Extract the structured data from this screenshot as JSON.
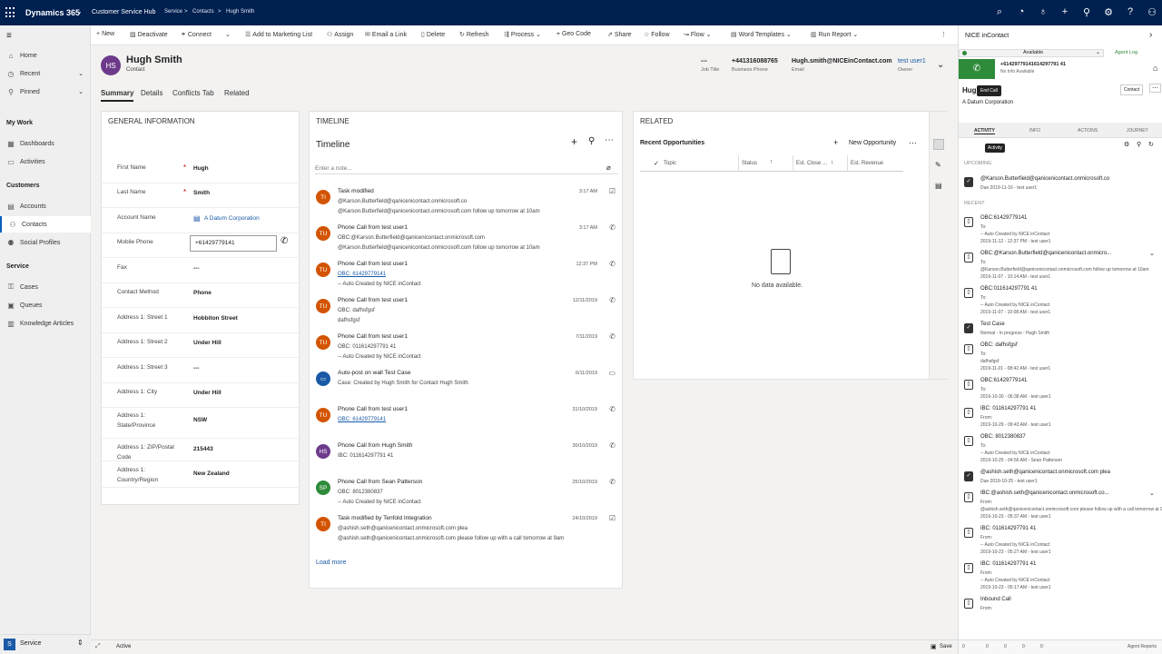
{
  "topbar": {
    "brand": "Dynamics 365",
    "app": "Customer Service Hub",
    "crumbs": [
      "Service",
      ">",
      "Contacts",
      ">",
      "Hugh Smith"
    ]
  },
  "nav": {
    "items_top": [
      "Home",
      "Recent",
      "Pinned"
    ],
    "my_work_head": "My Work",
    "my_work": [
      "Dashboards",
      "Activities"
    ],
    "customers_head": "Customers",
    "customers": [
      "Accounts",
      "Contacts",
      "Social Profiles"
    ],
    "service_head": "Service",
    "service": [
      "Cases",
      "Queues",
      "Knowledge Articles"
    ],
    "area": "Service",
    "area_badge": "S"
  },
  "commands": [
    "New",
    "Deactivate",
    "Connect",
    "Add to Marketing List",
    "Assign",
    "Email a Link",
    "Delete",
    "Refresh",
    "Process",
    "Geo Code",
    "Share",
    "Follow",
    "Flow",
    "Word Templates",
    "Run Report"
  ],
  "record": {
    "initials": "HS",
    "name": "Hugh Smith",
    "entity": "Contact",
    "fields": [
      {
        "value": "---",
        "label": "Job Title"
      },
      {
        "value": "+441316088765",
        "label": "Business Phone"
      },
      {
        "value": "Hugh.smith@NICEinContact.com",
        "label": "Email"
      },
      {
        "value": "test user1",
        "label": "Owner"
      }
    ]
  },
  "tabs": [
    "Summary",
    "Details",
    "Conflicts Tab",
    "Related"
  ],
  "general": {
    "heading": "GENERAL INFORMATION",
    "rows": [
      {
        "label": "First Name",
        "value": "Hugh",
        "required": "*"
      },
      {
        "label": "Last Name",
        "value": "Smith",
        "required": "*"
      },
      {
        "label": "Account Name",
        "value": "A Datum Corporation"
      },
      {
        "label": "Mobile Phone",
        "value": "+61429779141"
      },
      {
        "label": "Fax",
        "value": "---"
      },
      {
        "label": "Contact Method",
        "value": "Phone"
      },
      {
        "label": "Address 1: Street 1",
        "value": "Hobbiton Street"
      },
      {
        "label": "Address 1: Street 2",
        "value": "Under Hill"
      },
      {
        "label": "Address 1: Street 3",
        "value": "---"
      },
      {
        "label": "Address 1: City",
        "value": "Under Hill"
      },
      {
        "label": "Address 1: State/Province",
        "value": "NSW"
      },
      {
        "label": "Address 1: ZIP/Postal Code",
        "value": "215443"
      },
      {
        "label": "Address 1: Country/Region",
        "value": "New Zealand"
      }
    ]
  },
  "timeline": {
    "heading": "TIMELINE",
    "title": "Timeline",
    "note_placeholder": "Enter a note...",
    "load_more": "Load more",
    "items": [
      {
        "initials": "TI",
        "color": "#d35400",
        "title": "Task modified",
        "lines": [
          "@Karson.Butterfield@qanicenicontact.onmicrosoft.co",
          "@Karson.Butterfield@qanicenicontact.onmicrosoft.com follow up tomorrow at 10am"
        ],
        "date": "3:17 AM",
        "icon": "☑"
      },
      {
        "initials": "TU",
        "color": "#d35400",
        "title": "Phone Call from test user1",
        "lines": [
          "OBC:@Karson.Butterfield@qanicenicontact.onmicrosoft.com",
          "@Karson.Butterfield@qanicenicontact.onmicrosoft.com follow up tomorrow at 10am"
        ],
        "date": "3:17 AM",
        "icon": "✆"
      },
      {
        "initials": "TU",
        "color": "#d35400",
        "title": "Phone Call from test user1",
        "lines": [
          "OBC: 61429779141",
          "-- Auto Created by NICE inContact"
        ],
        "date": "12:37 PM",
        "icon": "✆",
        "link_first": true
      },
      {
        "initials": "TU",
        "color": "#d35400",
        "title": "Phone Call from test user1",
        "lines": [
          "OBC: dafhsfgsf",
          "dafhsfgsf"
        ],
        "date": "12/11/2019",
        "icon": "✆"
      },
      {
        "initials": "TU",
        "color": "#d35400",
        "title": "Phone Call from test user1",
        "lines": [
          "OBC: 011614297791 41",
          "-- Auto Created by NICE inContact"
        ],
        "date": "7/11/2019",
        "icon": "✆"
      },
      {
        "initials": "",
        "color": "#1a5aa6",
        "title": "Auto-post on wall Test Case",
        "lines": [
          "Case: Created by Hugh Smith for Contact Hugh Smith"
        ],
        "date": "6/11/2019",
        "icon": "▭"
      },
      {
        "initials": "TU",
        "color": "#d35400",
        "title": "Phone Call from test user1",
        "lines": [
          "OBC: 61429779141"
        ],
        "date": "31/10/2019",
        "icon": "✆",
        "link_first": true
      },
      {
        "initials": "HS",
        "color": "#6d3a8b",
        "title": "Phone Call from Hugh Smith",
        "lines": [
          "IBC: 011614297791 41"
        ],
        "date": "30/10/2019",
        "icon": "✆"
      },
      {
        "initials": "SP",
        "color": "#2e8b3a",
        "title": "Phone Call from Sean Patterson",
        "lines": [
          "OBC: 8012380837",
          "-- Auto Created by NICE inContact"
        ],
        "date": "25/10/2019",
        "icon": "✆"
      },
      {
        "initials": "TI",
        "color": "#d35400",
        "title": "Task modified by Tenfold Integration",
        "lines": [
          "@ashish.seth@qanicenicontact.onmicrosoft.com plea",
          "@ashish.seth@qanicenicontact.onmicrosoft.com please follow up with a call tomorrow at 9am"
        ],
        "date": "24/10/2019",
        "icon": "☑"
      }
    ]
  },
  "related": {
    "heading": "RELATED",
    "subgrid_title": "Recent Opportunities",
    "new_label": "New Opportunity",
    "columns": [
      "Topic",
      "Status",
      "Est. Close ...",
      "Est. Revenue"
    ],
    "empty": "No data available."
  },
  "nice": {
    "title": "NICE inContact",
    "status": "Available",
    "agent_log": "Agent Log",
    "call_number": "+61429779141614297791 41",
    "call_sub": "No Info Available",
    "end_call": "End Call",
    "contact_name": "Hugh",
    "contact_company": "A Datum Corporation",
    "contact_btn": "Contact",
    "tabs": [
      "ACTIVITY",
      "INFO",
      "ACTIONS",
      "JOURNEY"
    ],
    "tooltip": "Activity",
    "upcoming": "UPCOMING",
    "recent": "RECENT",
    "upcoming_items": [
      {
        "title": "@Karson.Butterfield@qanicenicontact.onmicrosoft.co",
        "sub": "Due 2019-11-16 - test user1",
        "type": "task"
      }
    ],
    "recent_items": [
      {
        "title": "OBC:61429779141",
        "lines": [
          "To:",
          "-- Auto Created by NICE inContact",
          "2019-11-12 - 12:37 PM - test user1"
        ],
        "type": "call"
      },
      {
        "title": "OBC:@Karson.Butterfield@qanicenicontact.onmicro...",
        "lines": [
          "To:",
          "@Karson.Butterfield@qanicenicontact.onmicrosoft.com follow up tomorrow at 10am",
          "2019-11-07 - 10:14 AM - test user1"
        ],
        "type": "call",
        "chev": true
      },
      {
        "title": "OBC:011614297791 41",
        "lines": [
          "To:",
          "-- Auto Created by NICE inContact",
          "2019-11-07 - 10:08 AM - test user1"
        ],
        "type": "call"
      },
      {
        "title": "Test Case",
        "lines": [
          "Normal - In progress - Hugh Smith"
        ],
        "type": "task"
      },
      {
        "title": "OBC: dafhsfgsf",
        "lines": [
          "To:",
          "dafhsfgsf",
          "2019-11-01 - 08:42 AM - test user1"
        ],
        "type": "call"
      },
      {
        "title": "OBC:61429779141",
        "lines": [
          "To:",
          "2019-10-30 - 06:38 AM - test user1"
        ],
        "type": "call"
      },
      {
        "title": "IBC: 011614297791 41",
        "lines": [
          "From:",
          "2019-10-29 - 09:43 AM - test user1"
        ],
        "type": "call"
      },
      {
        "title": "OBC: 8012380837",
        "lines": [
          "To:",
          "-- Auto Created by NICE inContact",
          "2019-10-25 - 04:56 AM - Sean Patterson"
        ],
        "type": "call"
      },
      {
        "title": "@ashish.seth@qanicenicontact.onmicrosoft.com plea",
        "lines": [
          "Due 2019-10-25 - test user1"
        ],
        "type": "task"
      },
      {
        "title": "IBC:@ashish.seth@qanicenicontact.onmicrosoft.co...",
        "lines": [
          "From:",
          "@ashish.seth@qanicenicontact.onmicrosoft.com please follow up with a call tomorrow at 9am",
          "2019-10-23 - 05:37 AM - test user1"
        ],
        "type": "call",
        "chev": true
      },
      {
        "title": "IBC: 011614297791 41",
        "lines": [
          "From:",
          "-- Auto Created by NICE inContact",
          "2019-10-23 - 05:27 AM - test user1"
        ],
        "type": "call"
      },
      {
        "title": "IBC: 011614297791 41",
        "lines": [
          "From:",
          "-- Auto Created by NICE inContact",
          "2019-10-23 - 05:17 AM - test user1"
        ],
        "type": "call"
      },
      {
        "title": "Inbound Call",
        "lines": [
          "From:"
        ],
        "type": "call"
      }
    ],
    "footer_counts": [
      "0",
      "0",
      "0",
      "0",
      "0"
    ],
    "footer_right": "Agent Reports"
  },
  "status": {
    "state": "Active",
    "save": "Save"
  }
}
